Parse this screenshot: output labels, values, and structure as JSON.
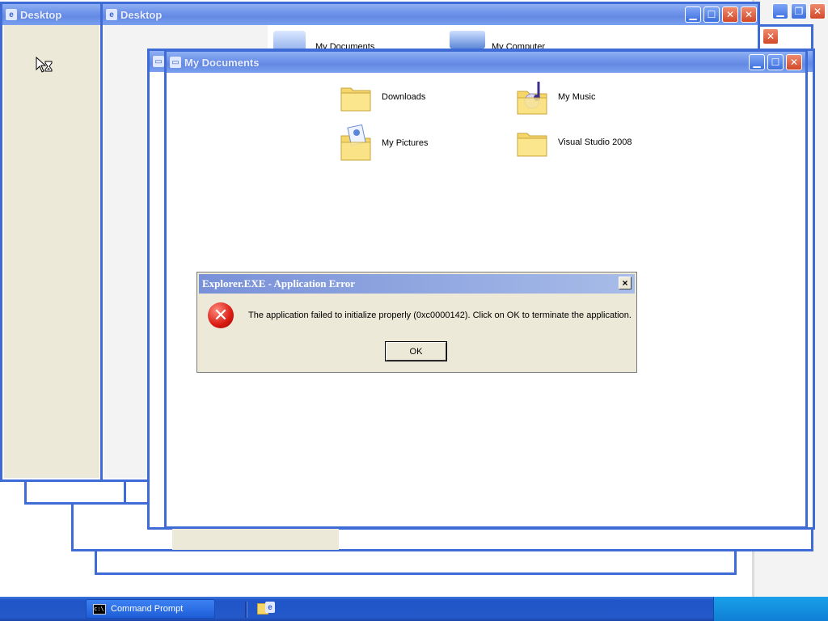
{
  "windows": {
    "desktop1": {
      "title": "Desktop"
    },
    "desktop2": {
      "title": "Desktop"
    },
    "mydocs": {
      "title": "My Documents",
      "items": [
        {
          "label": "Downloads",
          "icon": "folder-icon"
        },
        {
          "label": "My Music",
          "icon": "music-folder-icon"
        },
        {
          "label": "My Pictures",
          "icon": "pictures-folder-icon"
        },
        {
          "label": "Visual Studio 2008",
          "icon": "folder-icon"
        }
      ]
    },
    "behind_items": [
      "My Documents",
      "My Computer"
    ]
  },
  "dialog": {
    "title": "Explorer.EXE - Application Error",
    "message": "The application failed to initialize properly (0xc0000142). Click on OK to terminate the application.",
    "ok_label": "OK",
    "close_glyph": "×",
    "icon": "error-icon"
  },
  "taskbar": {
    "items": [
      {
        "label": "Command Prompt",
        "icon": "cmd-icon"
      }
    ]
  },
  "colors": {
    "xp_blue": "#3f6bd6",
    "dialog_bg": "#ece9d8",
    "taskbar": "#2459c9"
  }
}
